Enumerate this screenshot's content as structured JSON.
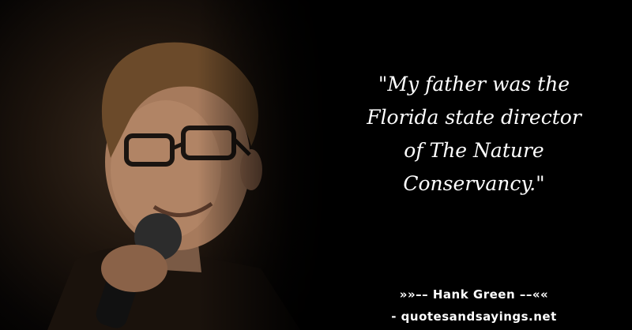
{
  "quote": {
    "lines": [
      "\"My father was the",
      "Florida state director",
      "of The Nature",
      "Conservancy.\""
    ]
  },
  "attribution": {
    "author_line": "»»–– Hank Green ––««",
    "site_line": "- quotesandsayings.net"
  },
  "colors": {
    "background": "#000000",
    "text": "#ffffff"
  }
}
